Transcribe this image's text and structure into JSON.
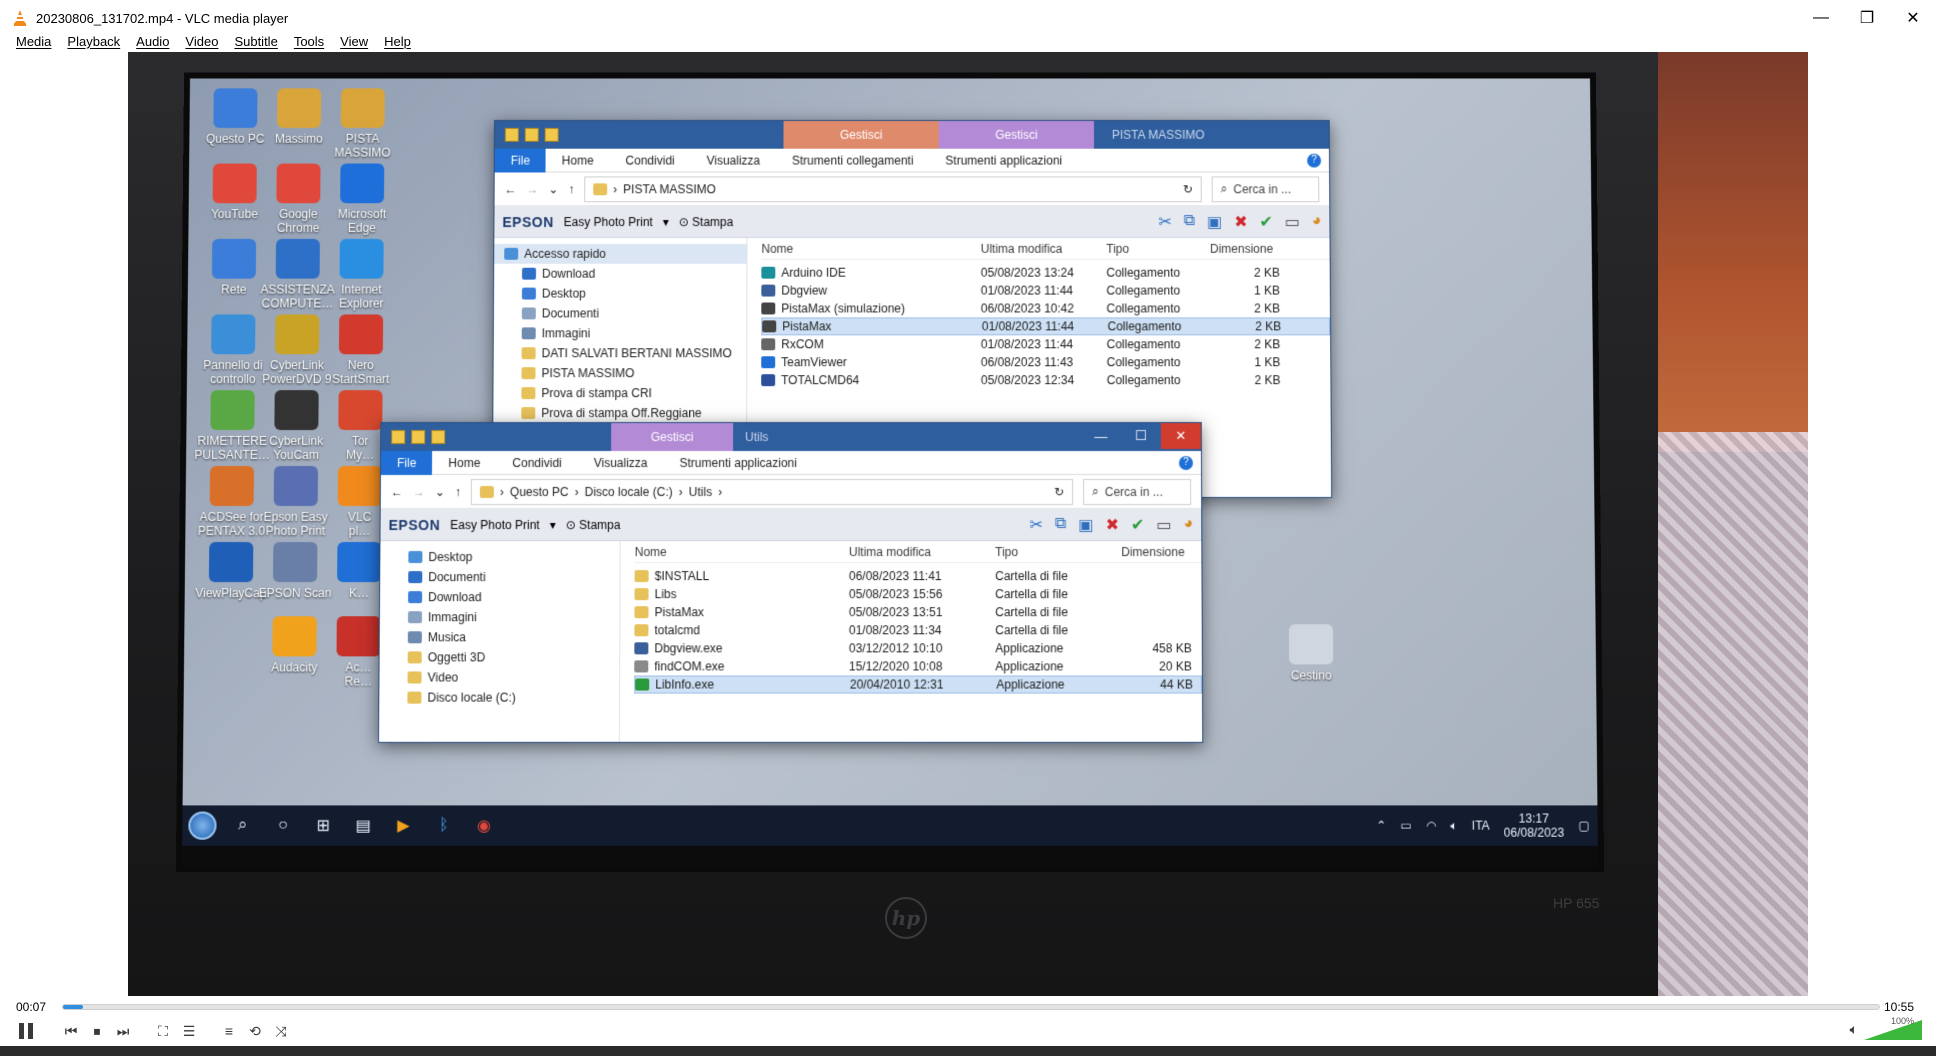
{
  "window": {
    "title": "20230806_131702.mp4 - VLC media player",
    "minimize": "—",
    "maximize": "❐",
    "close": "✕"
  },
  "menu": [
    "Media",
    "Playback",
    "Audio",
    "Video",
    "Subtitle",
    "Tools",
    "View",
    "Help"
  ],
  "video_frame": {
    "laptop_brand": "hp",
    "laptop_model": "HP 655",
    "desktop_icons": [
      {
        "label": "Questo PC",
        "icon": "computer-icon",
        "color": "#3b7dd8"
      },
      {
        "label": "Massimo",
        "icon": "user-folder-icon",
        "color": "#d9a43a"
      },
      {
        "label": "PISTA\nMASSIMO",
        "icon": "folder-icon",
        "color": "#d9a43a"
      },
      {
        "label": "YouTube",
        "icon": "chrome-icon",
        "color": "#e0483b"
      },
      {
        "label": "Google\nChrome",
        "icon": "chrome-icon",
        "color": "#e0483b"
      },
      {
        "label": "Microsoft\nEdge",
        "icon": "edge-icon",
        "color": "#1e6fd9"
      },
      {
        "label": "Rete",
        "icon": "network-icon",
        "color": "#3b7dd8"
      },
      {
        "label": "ASSISTENZA\nCOMPUTE…",
        "icon": "support-icon",
        "color": "#2e6fc8"
      },
      {
        "label": "Internet\nExplorer",
        "icon": "ie-icon",
        "color": "#2a8fe0"
      },
      {
        "label": "Pannello di\ncontrollo",
        "icon": "control-panel-icon",
        "color": "#3b8fd8"
      },
      {
        "label": "CyberLink\nPowerDVD 9",
        "icon": "powerdvd-icon",
        "color": "#c9a326"
      },
      {
        "label": "Nero\nStartSmart",
        "icon": "nero-icon",
        "color": "#d23a2e"
      },
      {
        "label": "RIMETTERE\nPULSANTE…",
        "icon": "shortcut-icon",
        "color": "#5aa845"
      },
      {
        "label": "CyberLink\nYouCam",
        "icon": "youcam-icon",
        "color": "#333333"
      },
      {
        "label": "Tor\nMy…",
        "icon": "shortcut-icon",
        "color": "#d8482f"
      },
      {
        "label": "ACDSee for\nPENTAX 3.0",
        "icon": "acdsee-icon",
        "color": "#d9702a"
      },
      {
        "label": "Epson Easy\nPhoto Print",
        "icon": "epson-icon",
        "color": "#5a6fb2"
      },
      {
        "label": "VLC\npl…",
        "icon": "vlc-icon",
        "color": "#f08a1d"
      },
      {
        "label": "ViewPlayCap",
        "icon": "viewplaycap-icon",
        "color": "#1f5fb8"
      },
      {
        "label": "EPSON Scan",
        "icon": "scanner-icon",
        "color": "#6a7fa8"
      },
      {
        "label": "K…",
        "icon": "shortcut-icon",
        "color": "#1f6fd6"
      },
      {
        "label": "Audacity",
        "icon": "audacity-icon",
        "color": "#f0a21d"
      },
      {
        "label": "Ac…\nRe…",
        "icon": "shortcut-icon",
        "color": "#c8302a"
      },
      {
        "label": "Cestino",
        "icon": "recycle-bin-icon",
        "color": "#cfd6df"
      }
    ],
    "explorer_back": {
      "context_tabs": [
        "Gestisci",
        "Gestisci"
      ],
      "window_title": "PISTA MASSIMO",
      "ribbon_tabs": [
        "File",
        "Home",
        "Condividi",
        "Visualizza",
        "Strumenti collegamenti",
        "Strumenti applicazioni"
      ],
      "path": [
        "PISTA MASSIMO"
      ],
      "search_placeholder": "Cerca in ...",
      "toolbar": {
        "brand": "EPSON",
        "app": "Easy Photo Print",
        "print": "Stampa"
      },
      "nav": [
        "Accesso rapido",
        "Download",
        "Desktop",
        "Documenti",
        "Immagini",
        "DATI SALVATI BERTANI MASSIMO",
        "PISTA MASSIMO",
        "Prova di stampa CRI",
        "Prova di stampa Off.Reggiane"
      ],
      "columns": [
        "Nome",
        "Ultima modifica",
        "Tipo",
        "Dimensione"
      ],
      "rows": [
        {
          "name": "Arduino IDE",
          "date": "05/08/2023 13:24",
          "type": "Collegamento",
          "size": "2 KB",
          "icon": "arduino-icon"
        },
        {
          "name": "Dbgview",
          "date": "01/08/2023 11:44",
          "type": "Collegamento",
          "size": "1 KB",
          "icon": "dbgview-icon"
        },
        {
          "name": "PistaMax (simulazione)",
          "date": "06/08/2023 10:42",
          "type": "Collegamento",
          "size": "2 KB",
          "icon": "pistamax-icon"
        },
        {
          "name": "PistaMax",
          "date": "01/08/2023 11:44",
          "type": "Collegamento",
          "size": "2 KB",
          "icon": "pistamax-icon"
        },
        {
          "name": "RxCOM",
          "date": "01/08/2023 11:44",
          "type": "Collegamento",
          "size": "2 KB",
          "icon": "rxcom-icon"
        },
        {
          "name": "TeamViewer",
          "date": "06/08/2023 11:43",
          "type": "Collegamento",
          "size": "1 KB",
          "icon": "teamviewer-icon"
        },
        {
          "name": "TOTALCMD64",
          "date": "05/08/2023 12:34",
          "type": "Collegamento",
          "size": "2 KB",
          "icon": "totalcmd-icon"
        }
      ]
    },
    "explorer_front": {
      "context_tab": "Gestisci",
      "window_title": "Utils",
      "ribbon_tabs": [
        "File",
        "Home",
        "Condividi",
        "Visualizza",
        "Strumenti applicazioni"
      ],
      "path": [
        "Questo PC",
        "Disco locale (C:)",
        "Utils"
      ],
      "search_placeholder": "Cerca in ...",
      "toolbar": {
        "brand": "EPSON",
        "app": "Easy Photo Print",
        "print": "Stampa"
      },
      "nav": [
        "Desktop",
        "Documenti",
        "Download",
        "Immagini",
        "Musica",
        "Oggetti 3D",
        "Video",
        "Disco locale (C:)"
      ],
      "columns": [
        "Nome",
        "Ultima modifica",
        "Tipo",
        "Dimensione"
      ],
      "rows": [
        {
          "name": "$INSTALL",
          "date": "06/08/2023 11:41",
          "type": "Cartella di file",
          "size": "",
          "icon": "folder-icon"
        },
        {
          "name": "Libs",
          "date": "05/08/2023 15:56",
          "type": "Cartella di file",
          "size": "",
          "icon": "folder-icon"
        },
        {
          "name": "PistaMax",
          "date": "05/08/2023 13:51",
          "type": "Cartella di file",
          "size": "",
          "icon": "folder-icon"
        },
        {
          "name": "totalcmd",
          "date": "01/08/2023 11:34",
          "type": "Cartella di file",
          "size": "",
          "icon": "folder-icon"
        },
        {
          "name": "Dbgview.exe",
          "date": "03/12/2012 10:10",
          "type": "Applicazione",
          "size": "458 KB",
          "icon": "dbgview-icon"
        },
        {
          "name": "findCOM.exe",
          "date": "15/12/2020 10:08",
          "type": "Applicazione",
          "size": "20 KB",
          "icon": "app-icon"
        },
        {
          "name": "LibInfo.exe",
          "date": "20/04/2010 12:31",
          "type": "Applicazione",
          "size": "44 KB",
          "icon": "libinfo-icon"
        }
      ]
    },
    "taskbar": {
      "lang": "ITA",
      "time": "13:17",
      "date": "06/08/2023"
    }
  },
  "playback": {
    "current_time": "00:07",
    "total_time": "10:55",
    "progress": 0.011,
    "volume_label": "100%",
    "volume": 1.0
  },
  "colors": {
    "seek": "#2f8fe2",
    "volume": "#3cb93c"
  }
}
